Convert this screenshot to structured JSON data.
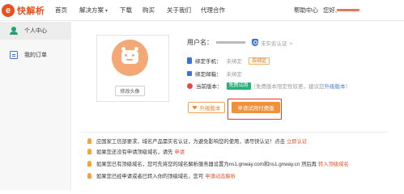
{
  "brand": {
    "name": "快解析",
    "mark": "e"
  },
  "nav": {
    "home": "首页",
    "solutions": "解决方案",
    "solutions_caret": "▾",
    "download": "下载",
    "buy": "购买",
    "about": "关于我们",
    "agent": "代理合作",
    "help": "帮助中心",
    "hello": "您好,"
  },
  "sidebar": {
    "items": [
      {
        "label": "个人中心",
        "icon": "person-icon",
        "active": true
      },
      {
        "label": "我的订单",
        "icon": "order-icon",
        "active": false
      }
    ]
  },
  "avatar": {
    "change_button": "修改头像"
  },
  "profile": {
    "username_label": "用户名：",
    "verify_status": "未实名认证",
    "verify_caret": ">",
    "phone_label": "绑定手机：",
    "phone_value": "未绑定",
    "bind_button": "去绑定",
    "email_label": "绑定邮箱：",
    "email_value": "未绑定",
    "version_label": "当前版本：",
    "version_tag": "免费试用",
    "version_note": "（免费版本限定性较差，建议您",
    "version_link": "升级版本",
    "version_note_end": "）"
  },
  "actions": {
    "upgrade": "升级版本",
    "trial": "申请试用付费版"
  },
  "notes": [
    {
      "text": "应国家工信部要求，域名产品需实名认证，为避免影响您的使用，请尽快认证！点击",
      "link": "立即认证"
    },
    {
      "text": "如果您还没有申请顶级域名，请先",
      "link": "申请"
    },
    {
      "text": "如果您已有顶级域名，您可先将您的域名解析服务器设置为ns1.gnway.com和ns1.gnway.cn 然后再",
      "link": "转入顶级域名"
    },
    {
      "text": "如果您已经申请或者已转入你的顶级域名，您可",
      "link": "申请动态解析"
    }
  ],
  "colors": {
    "accent": "#e8501e",
    "button_orange": "#f0913a",
    "highlight_red": "#e53b2c",
    "free_green": "#2bb27c",
    "verify_blue": "#3c74d6"
  }
}
